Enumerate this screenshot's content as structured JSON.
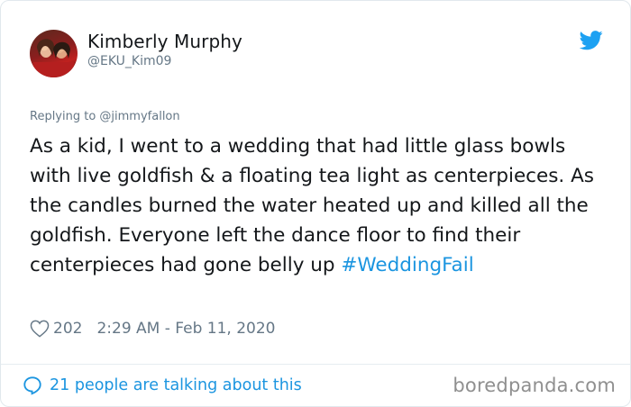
{
  "tweet": {
    "author_name": "Kimberly Murphy",
    "author_handle": "@EKU_Kim09",
    "reply_context": "Replying to @jimmyfallon",
    "text": "As a kid, I went to a wedding that had little glass bowls with live goldfish & a floating tea light as centerpieces. As the candles burned the water heated up and killed all the goldfish. Everyone left the dance floor to find their centerpieces had gone belly up ",
    "hashtag": "#WeddingFail",
    "likes": "202",
    "timestamp": "2:29 AM - Feb 11, 2020"
  },
  "footer": {
    "talking": "21 people are talking about this",
    "watermark": "boredpanda.com"
  },
  "colors": {
    "link": "#1b95e0",
    "secondary_text": "#657786",
    "primary_text": "#14171a"
  },
  "icons": [
    "avatar",
    "twitter-bird-icon",
    "heart-icon",
    "speech-bubble-icon"
  ]
}
